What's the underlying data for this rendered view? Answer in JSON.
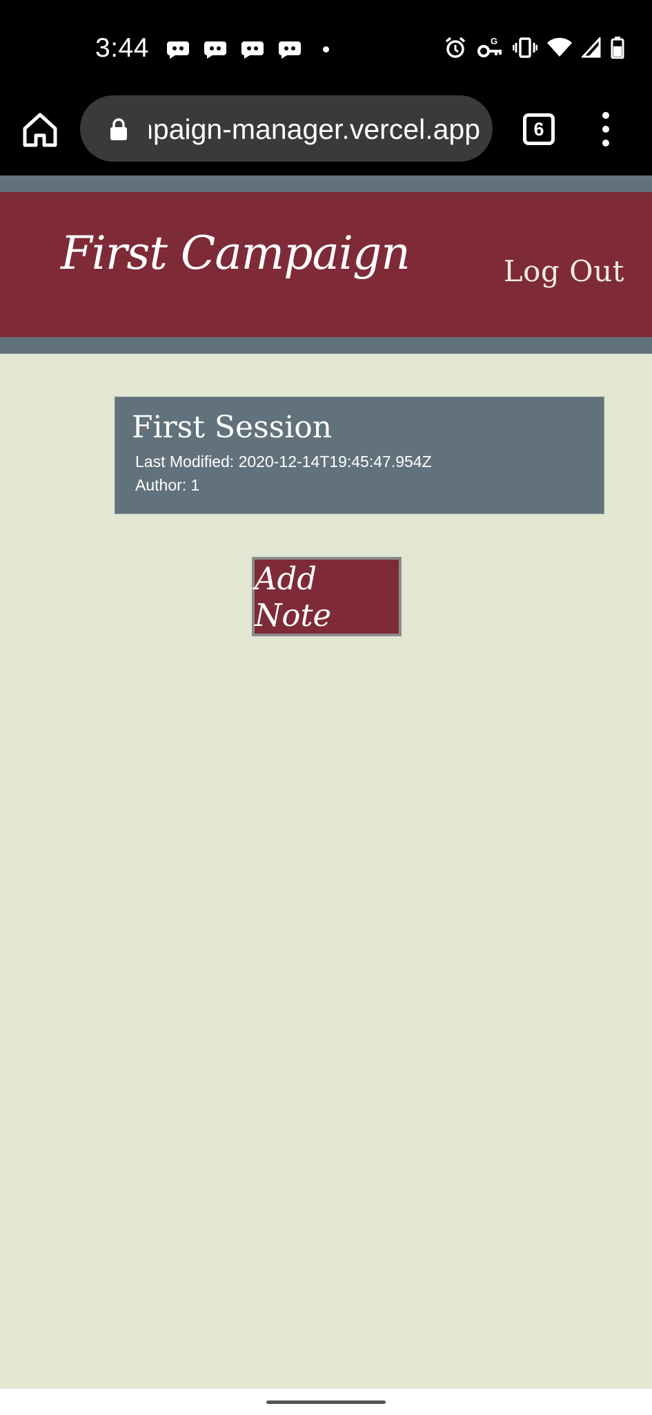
{
  "status_bar": {
    "time": "3:44",
    "notification_icons": [
      "discord-icon",
      "discord-icon",
      "discord-icon",
      "discord-icon"
    ],
    "system_icons": [
      "alarm-icon",
      "vpn-key-icon",
      "vibrate-icon",
      "wifi-icon",
      "signal-icon",
      "battery-icon"
    ]
  },
  "browser": {
    "url": "campaign-manager.vercel.app",
    "tab_count": "6"
  },
  "app": {
    "title": "First Campaign",
    "logout_label": "Log Out"
  },
  "session": {
    "title": "First Session",
    "last_modified": "Last Modified: 2020-12-14T19:45:47.954Z",
    "author": "Author: 1"
  },
  "actions": {
    "add_note_label": "Add Note"
  },
  "colors": {
    "header_bg": "#7e2b37",
    "slate": "#62727c",
    "page_bg": "#e1e7d1"
  }
}
